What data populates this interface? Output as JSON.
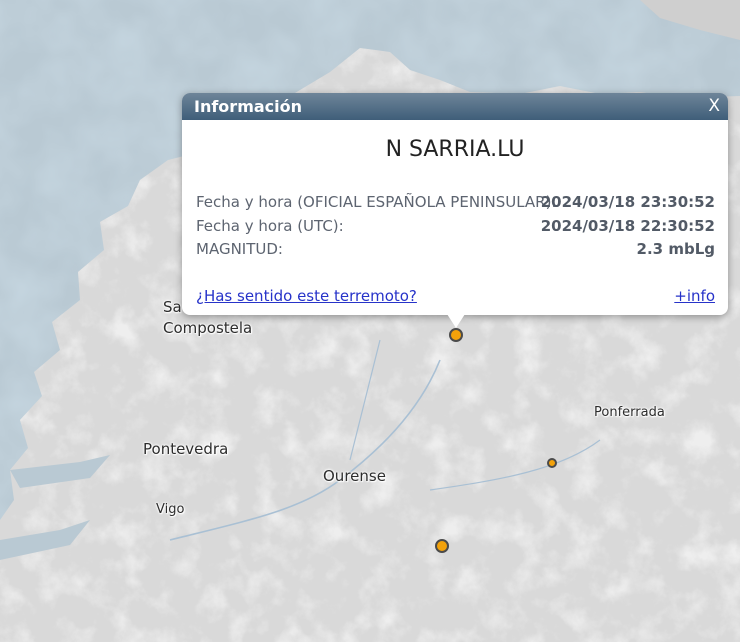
{
  "map": {
    "colors": {
      "sea": "#b9c9d3",
      "land": "#dcdcdc",
      "quake_fill": "#f3a20b"
    },
    "cities": [
      {
        "id": "santiago",
        "label": "Santiago de\nCompostela",
        "visible_label": "Sa",
        "line2": "Compostela"
      },
      {
        "id": "pontevedra",
        "label": "Pontevedra"
      },
      {
        "id": "ourense",
        "label": "Ourense"
      },
      {
        "id": "vigo",
        "label": "Vigo"
      },
      {
        "id": "ponferrada",
        "label": "Ponferrada"
      }
    ],
    "markers": [
      "earthquake-marker",
      "earthquake-marker",
      "earthquake-marker"
    ]
  },
  "popup": {
    "title": "Información",
    "close_label": "X",
    "place": "N SARRIA.LU",
    "rows": [
      {
        "label": "Fecha y hora (OFICIAL ESPAÑOLA PENINSULAR):",
        "value": "2024/03/18 23:30:52"
      },
      {
        "label": "Fecha y hora (UTC):",
        "value": "2024/03/18 22:30:52"
      },
      {
        "label": "MAGNITUD:",
        "value": "2.3 mbLg"
      }
    ],
    "felt_link": "¿Has sentido este terremoto?",
    "info_link": "+info"
  }
}
